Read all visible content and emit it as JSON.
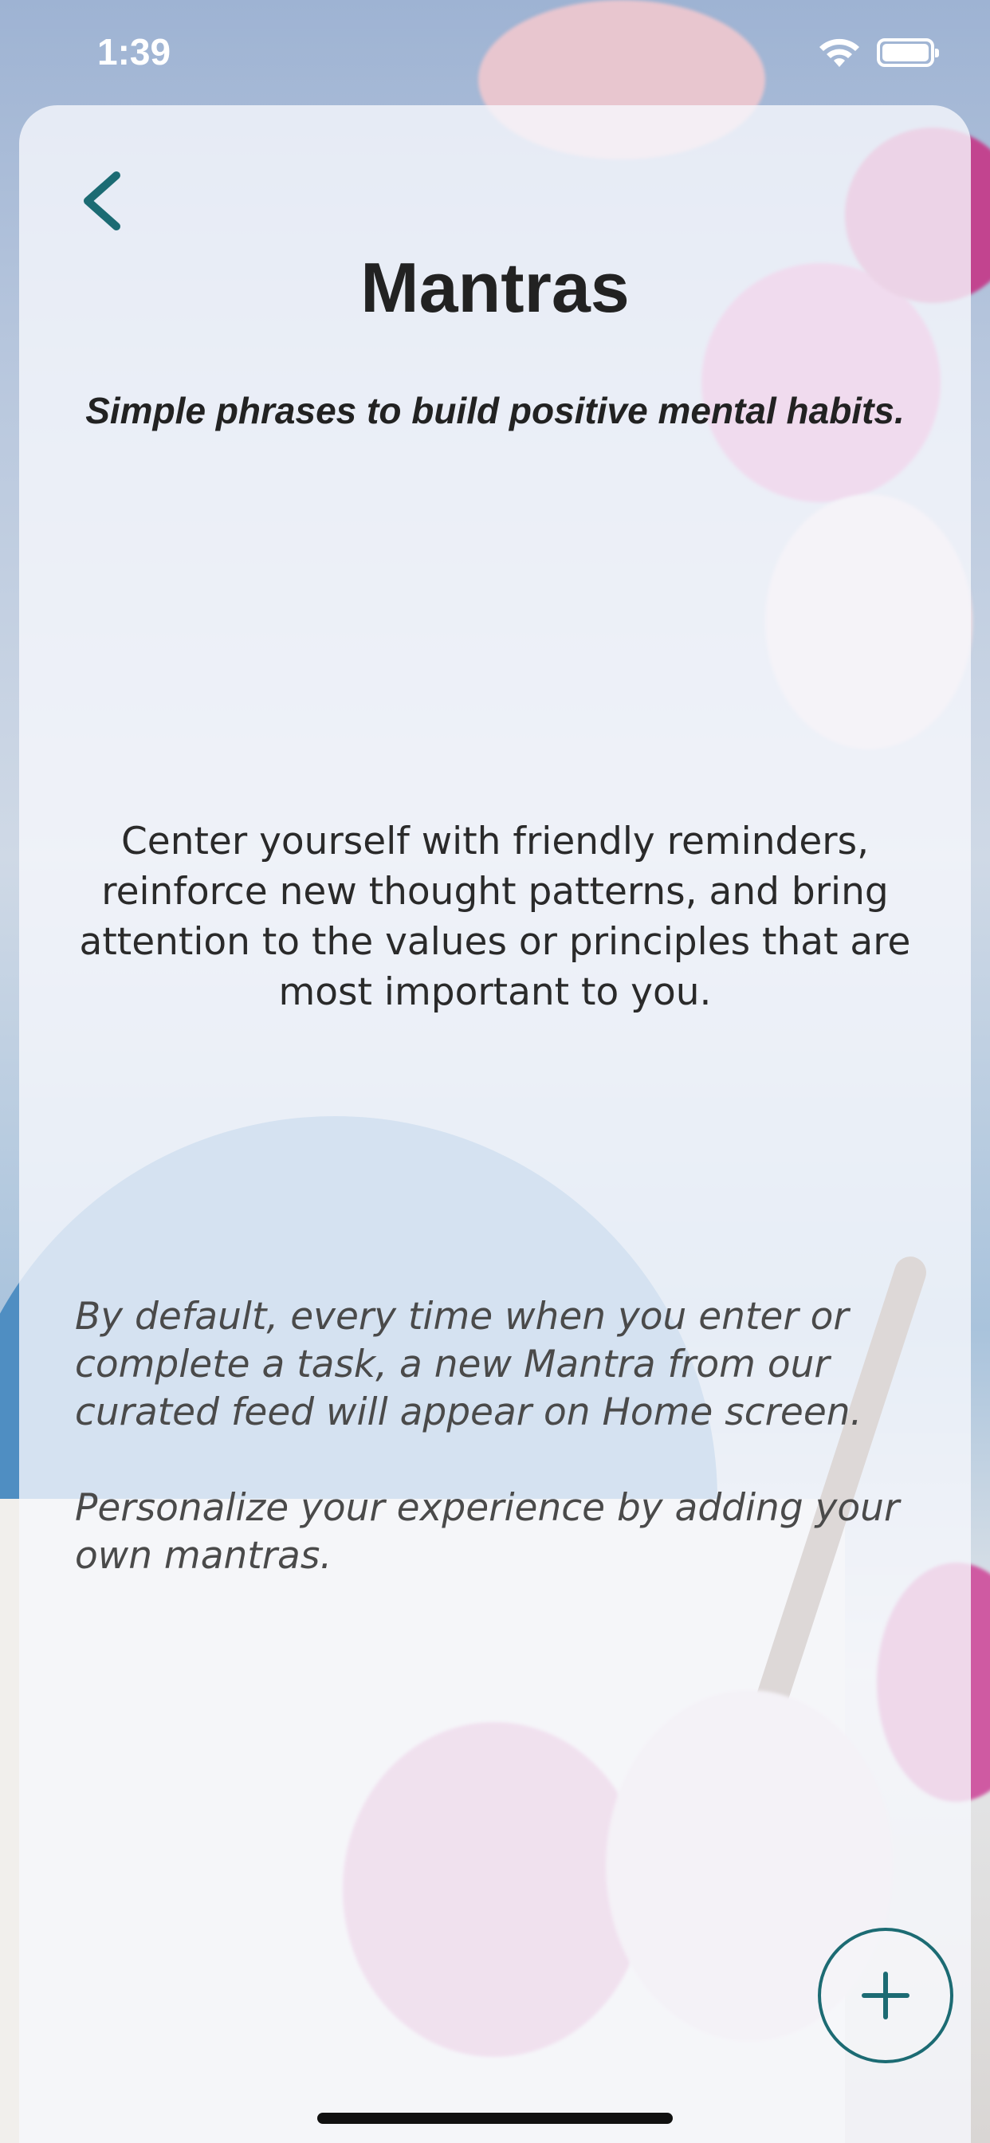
{
  "status_bar": {
    "time": "1:39",
    "wifi_icon": "wifi-icon",
    "battery_icon": "battery-icon"
  },
  "header": {
    "back_icon": "chevron-left-icon",
    "title": "Mantras",
    "subtitle": "Simple phrases to build positive mental habits."
  },
  "content": {
    "intro": "Center yourself with friendly reminders, reinforce new thought patterns, and bring attention to the values or principles that are most important to you.",
    "note_default": "By default, every time when you enter or complete a task, a new Mantra from our curated feed will appear on Home screen.",
    "note_personalize": "Personalize your experience by adding your own mantras."
  },
  "actions": {
    "add_icon": "plus-icon"
  },
  "colors": {
    "accent": "#1c6b73",
    "title_text": "#222222",
    "note_text": "#4a4a4a"
  }
}
